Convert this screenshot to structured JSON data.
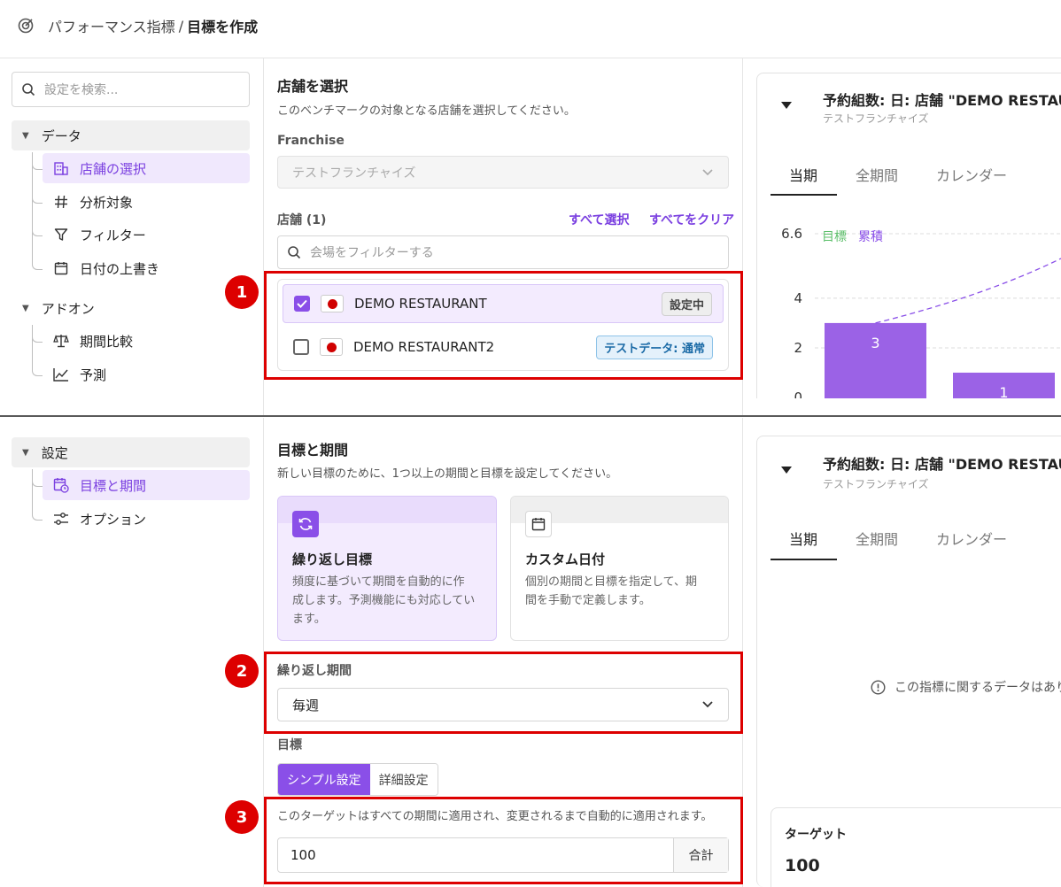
{
  "header": {
    "breadcrumb_parent": "パフォーマンス指標",
    "separator": "/",
    "breadcrumb_current": "目標を作成"
  },
  "sidebar": {
    "search_placeholder": "設定を検索...",
    "groups": [
      {
        "label": "データ",
        "items": [
          {
            "label": "店舗の選択",
            "icon": "building-icon",
            "active": true
          },
          {
            "label": "分析対象",
            "icon": "hash-icon"
          },
          {
            "label": "フィルター",
            "icon": "filter-icon"
          },
          {
            "label": "日付の上書き",
            "icon": "calendar-icon"
          }
        ]
      },
      {
        "label": "アドオン",
        "items": [
          {
            "label": "期間比較",
            "icon": "scale-icon"
          },
          {
            "label": "予測",
            "icon": "trend-icon"
          }
        ]
      },
      {
        "label": "設定",
        "items": [
          {
            "label": "目標と期間",
            "icon": "calendar-clock-icon",
            "active": true
          },
          {
            "label": "オプション",
            "icon": "sliders-icon"
          }
        ]
      }
    ]
  },
  "store_section": {
    "title": "店舗を選択",
    "description": "このベンチマークの対象となる店舗を選択してください。",
    "franchise_label": "Franchise",
    "franchise_value": "テストフランチャイズ",
    "stores_label": "店舗 (1)",
    "select_all": "すべて選択",
    "clear_all": "すべてをクリア",
    "filter_placeholder": "会場をフィルターする",
    "stores": [
      {
        "name": "DEMO RESTAURANT",
        "checked": true,
        "badge": "設定中"
      },
      {
        "name": "DEMO RESTAURANT2",
        "checked": false,
        "badge": "テストデータ: 通常"
      }
    ]
  },
  "goal_section": {
    "title": "目標と期間",
    "description": "新しい目標のために、1つ以上の期間と目標を設定してください。",
    "cards": [
      {
        "title": "繰り返し目標",
        "desc_line1": "頻度に基づいて期間を自動的に作",
        "desc_line2": "成します。予測機能にも対応してい",
        "desc_line3": "ます。",
        "selected": true
      },
      {
        "title": "カスタム日付",
        "desc_line1": "個別の期間と目標を指定して、期",
        "desc_line2": "間を手動で定義します。",
        "selected": false
      }
    ],
    "period_label": "繰り返し期間",
    "period_value": "毎週",
    "target_label": "目標",
    "mode_simple": "シンプル設定",
    "mode_detail": "詳細設定",
    "target_note": "このターゲットはすべての期間に適用され、変更されるまで自動的に適用されます。",
    "target_value": "100",
    "target_suffix": "合計"
  },
  "annotations": {
    "n1": "1",
    "n2": "2",
    "n3": "3"
  },
  "preview_top": {
    "title": "予約組数: 日: 店舗 \"DEMO RESTAU",
    "subtitle": "テストフランチャイズ",
    "tabs": [
      "当期",
      "全期間",
      "カレンダー"
    ],
    "legend_goal": "目標",
    "legend_cum": "累積"
  },
  "chart_data": {
    "type": "bar",
    "categories": [
      "",
      ""
    ],
    "values": [
      3,
      1
    ],
    "data_labels": [
      "3",
      "1"
    ],
    "yticks": [
      "6.6",
      "4",
      "2",
      "0"
    ],
    "ylim": [
      0,
      6.6
    ],
    "series": [
      {
        "name": "累積",
        "values": [
          3,
          1
        ]
      }
    ],
    "goal_line": true,
    "legend": [
      "目標",
      "累積"
    ],
    "legend_position": "top-left",
    "grid": true
  },
  "preview_bottom": {
    "title": "予約組数: 日: 店舗 \"DEMO RESTAU",
    "subtitle": "テストフランチャイズ",
    "tabs": [
      "当期",
      "全期間",
      "カレンダー"
    ],
    "empty_message": "この指標に関するデータはありま",
    "target_label": "ターゲット",
    "target_value": "100"
  },
  "colors": {
    "accent": "#8a4fe8",
    "annotation": "#dd0000",
    "goal": "#5cbf6a"
  }
}
